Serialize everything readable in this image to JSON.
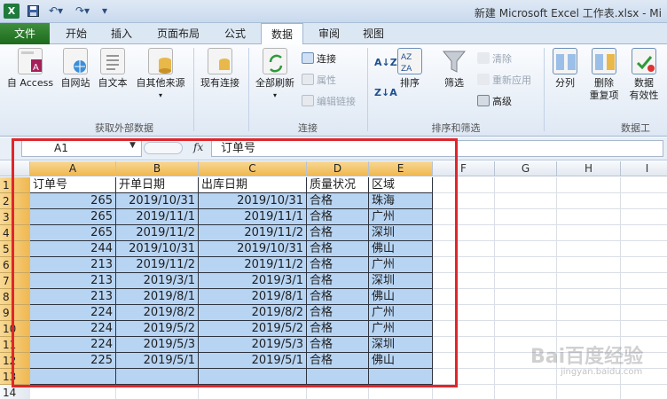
{
  "window": {
    "title": "新建 Microsoft Excel 工作表.xlsx - Mi"
  },
  "tabs": [
    {
      "label": "文件"
    },
    {
      "label": "开始"
    },
    {
      "label": "插入"
    },
    {
      "label": "页面布局"
    },
    {
      "label": "公式"
    },
    {
      "label": "数据"
    },
    {
      "label": "审阅"
    },
    {
      "label": "视图"
    }
  ],
  "ribbon": {
    "groups": {
      "external": "获取外部数据",
      "connections": "连接",
      "sort_filter": "排序和筛选",
      "tools": "数据工"
    },
    "external": {
      "from_access": "自 Access",
      "from_web": "自网站",
      "from_text": "自文本",
      "from_other": "自其他来源",
      "existing": "现有连接"
    },
    "connections": {
      "refresh_all": "全部刷新",
      "connections": "连接",
      "properties": "属性",
      "edit_links": "编辑链接"
    },
    "sort_filter": {
      "sort": "排序",
      "filter": "筛选",
      "clear": "清除",
      "reapply": "重新应用",
      "advanced": "高级"
    },
    "tools": {
      "split": "分列",
      "remove_dup_1": "删除",
      "remove_dup_2": "重复项",
      "validation_1": "数据",
      "validation_2": "有效性"
    }
  },
  "formula_bar": {
    "name_box": "A1",
    "fx": "fx",
    "content": "订单号"
  },
  "sheet": {
    "columns": [
      "A",
      "B",
      "C",
      "D",
      "E",
      "F",
      "G",
      "H",
      "I"
    ],
    "rows": [
      "1",
      "2",
      "3",
      "4",
      "5",
      "6",
      "7",
      "8",
      "9",
      "10",
      "11",
      "12",
      "13",
      "14"
    ],
    "header": [
      "订单号",
      "开单日期",
      "出库日期",
      "质量状况",
      "区域"
    ],
    "data": [
      [
        "265",
        "2019/10/31",
        "2019/10/31",
        "合格",
        "珠海"
      ],
      [
        "265",
        "2019/11/1",
        "2019/11/1",
        "合格",
        "广州"
      ],
      [
        "265",
        "2019/11/2",
        "2019/11/2",
        "合格",
        "深圳"
      ],
      [
        "244",
        "2019/10/31",
        "2019/10/31",
        "合格",
        "佛山"
      ],
      [
        "213",
        "2019/11/2",
        "2019/11/2",
        "合格",
        "广州"
      ],
      [
        "213",
        "2019/3/1",
        "2019/3/1",
        "合格",
        "深圳"
      ],
      [
        "213",
        "2019/8/1",
        "2019/8/1",
        "合格",
        "佛山"
      ],
      [
        "224",
        "2019/8/2",
        "2019/8/2",
        "合格",
        "广州"
      ],
      [
        "224",
        "2019/5/2",
        "2019/5/2",
        "合格",
        "广州"
      ],
      [
        "224",
        "2019/5/3",
        "2019/5/3",
        "合格",
        "深圳"
      ],
      [
        "225",
        "2019/5/1",
        "2019/5/1",
        "合格",
        "佛山"
      ]
    ]
  },
  "watermark": {
    "brand": "Bai百度经验",
    "url": "jingyan.baidu.com"
  },
  "colors": {
    "selection": "#b7d4f3",
    "highlight_frame": "#e0262b",
    "file_tab": "#1d6b1d"
  }
}
